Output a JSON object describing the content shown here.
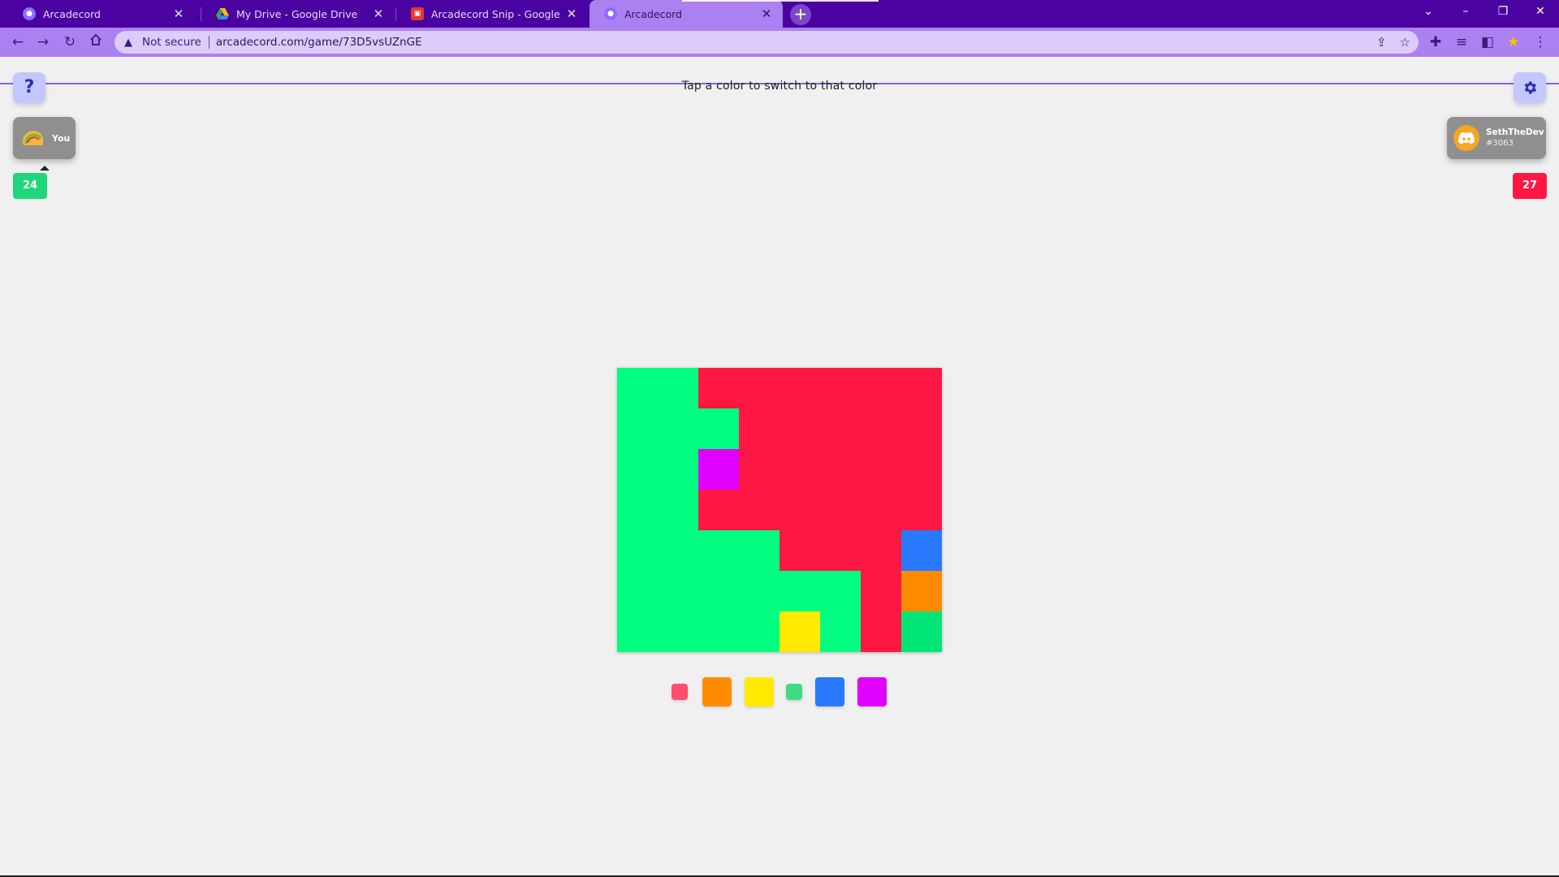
{
  "browser": {
    "tabs": [
      {
        "title": "Arcadecord",
        "favicon": "arcadecord-icon",
        "active": false
      },
      {
        "title": "My Drive - Google Drive",
        "favicon": "google-drive-icon",
        "active": false
      },
      {
        "title": "Arcadecord Snip - Google Drawi",
        "favicon": "google-drawings-icon",
        "active": false
      },
      {
        "title": "Arcadecord",
        "favicon": "arcadecord-icon",
        "active": true
      }
    ],
    "security_label": "Not secure",
    "url": "arcadecord.com/game/73D5vsUZnGE",
    "theme_color": "#4a02a0"
  },
  "game": {
    "instruction": "Tap a color to switch to that color",
    "help_label": "?",
    "player": {
      "label": "You",
      "score": "24",
      "color": "#1fd77b"
    },
    "opponent": {
      "name": "SethTheDev",
      "tag": "#3063",
      "score": "27",
      "color": "#ff1744"
    },
    "palette_colors": {
      "G": "#00ff80",
      "D": "#00e676",
      "R": "#ff1744",
      "M": "#e000ff",
      "Y": "#ffea00",
      "B": "#2979ff",
      "O": "#ff8c00"
    },
    "board": [
      [
        "G",
        "G",
        "R",
        "R",
        "R",
        "R",
        "R",
        "R"
      ],
      [
        "G",
        "G",
        "G",
        "R",
        "R",
        "R",
        "R",
        "R"
      ],
      [
        "G",
        "G",
        "M",
        "R",
        "R",
        "R",
        "R",
        "R"
      ],
      [
        "G",
        "G",
        "R",
        "R",
        "R",
        "R",
        "R",
        "R"
      ],
      [
        "G",
        "G",
        "G",
        "G",
        "R",
        "R",
        "R",
        "B"
      ],
      [
        "G",
        "G",
        "G",
        "G",
        "G",
        "G",
        "R",
        "O"
      ],
      [
        "G",
        "G",
        "G",
        "G",
        "Y",
        "G",
        "R",
        "D"
      ]
    ],
    "palette": [
      {
        "name": "red",
        "color": "#ff4d6d",
        "size": "small",
        "selected": true
      },
      {
        "name": "orange",
        "color": "#ff8c00",
        "size": "big"
      },
      {
        "name": "yellow",
        "color": "#ffea00",
        "size": "big"
      },
      {
        "name": "green",
        "color": "#3ddc84",
        "size": "small",
        "selected": true
      },
      {
        "name": "blue",
        "color": "#2979ff",
        "size": "big"
      },
      {
        "name": "magenta",
        "color": "#e000ff",
        "size": "big"
      }
    ]
  }
}
